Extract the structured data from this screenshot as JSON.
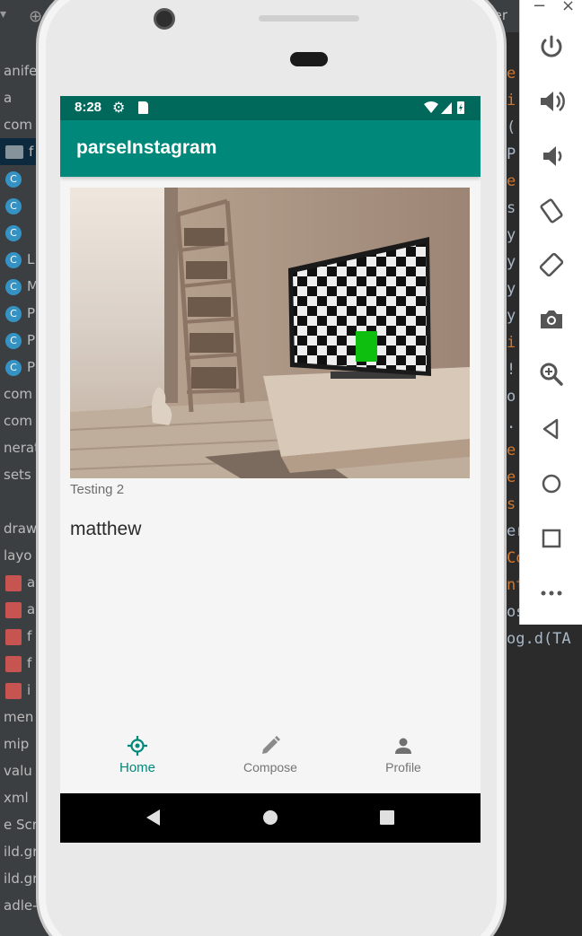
{
  "ide": {
    "tab_fragment": "mer",
    "tree": [
      {
        "label": "anifes",
        "kind": "text"
      },
      {
        "label": "a",
        "kind": "text"
      },
      {
        "label": "com",
        "kind": "text"
      },
      {
        "label": "f",
        "kind": "folder"
      },
      {
        "label": "",
        "kind": "badge"
      },
      {
        "label": "",
        "kind": "badge"
      },
      {
        "label": "",
        "kind": "badge"
      },
      {
        "label": "L",
        "kind": "badge"
      },
      {
        "label": "M",
        "kind": "badge"
      },
      {
        "label": "P",
        "kind": "badge"
      },
      {
        "label": "P",
        "kind": "badge"
      },
      {
        "label": "P",
        "kind": "badge"
      },
      {
        "label": "com",
        "kind": "text"
      },
      {
        "label": "com",
        "kind": "text"
      },
      {
        "label": "nerat",
        "kind": "text"
      },
      {
        "label": "sets",
        "kind": "text"
      },
      {
        "label": "",
        "kind": "text"
      },
      {
        "label": "draw",
        "kind": "text"
      },
      {
        "label": "layo",
        "kind": "text"
      },
      {
        "label": "a",
        "kind": "file"
      },
      {
        "label": "a",
        "kind": "file"
      },
      {
        "label": "f",
        "kind": "file"
      },
      {
        "label": "f",
        "kind": "file"
      },
      {
        "label": "i",
        "kind": "file"
      },
      {
        "label": "men",
        "kind": "text"
      },
      {
        "label": "mip",
        "kind": "text"
      },
      {
        "label": "valu",
        "kind": "text"
      },
      {
        "label": "xml",
        "kind": "text"
      },
      {
        "label": "e Scri",
        "kind": "text"
      },
      {
        "label": "ild.gr",
        "kind": "text"
      },
      {
        "label": "ild.gr",
        "kind": "text"
      },
      {
        "label": "adle-w",
        "kind": "text"
      }
    ],
    "code": [
      {
        "text": "e",
        "style": "orange"
      },
      {
        "text": "i",
        "style": "orange"
      },
      {
        "text": "(",
        "style": "plain"
      },
      {
        "text": "P",
        "style": "plain"
      },
      {
        "text": "e",
        "style": "orange"
      },
      {
        "text": "s",
        "style": "plain"
      },
      {
        "text": "y",
        "style": "plain"
      },
      {
        "text": "y",
        "style": "plain"
      },
      {
        "text": "y",
        "style": "plain"
      },
      {
        "text": "y",
        "style": "plain"
      },
      {
        "text": "i",
        "style": "orange"
      },
      {
        "text": "!",
        "style": "plain"
      },
      {
        "text": "o",
        "style": "plain"
      },
      {
        "text": ".",
        "style": "plain"
      },
      {
        "text": "e",
        "style": "orange"
      },
      {
        "text": "e",
        "style": "orange"
      },
      {
        "text": "s",
        "style": "orange"
      },
      {
        "text": "er.noti",
        "style": "plain"
      },
      {
        "text": "Contain",
        "style": "orange"
      },
      {
        "text": "nt i =",
        "style": "orange"
      },
      {
        "text": "ost pos",
        "style": "plain"
      },
      {
        "text": "og.d(TA",
        "style": "plain"
      }
    ]
  },
  "emulator": {
    "minimize": "−",
    "close": "×",
    "tools": [
      "power-icon",
      "volume-up-icon",
      "volume-down-icon",
      "rotate-left-icon",
      "rotate-right-icon",
      "camera-icon",
      "zoom-icon",
      "back-icon",
      "home-icon",
      "overview-icon",
      "more-icon"
    ]
  },
  "status_bar": {
    "time": "8:28"
  },
  "app": {
    "title": "parseInstagram",
    "accent": "#00897b",
    "status_color": "#00695c"
  },
  "post": {
    "description": "Testing 2",
    "username": "matthew"
  },
  "bottom_nav": {
    "items": [
      {
        "label": "Home",
        "icon": "home-target-icon",
        "active": true
      },
      {
        "label": "Compose",
        "icon": "pencil-icon",
        "active": false
      },
      {
        "label": "Profile",
        "icon": "person-icon",
        "active": false
      }
    ]
  }
}
